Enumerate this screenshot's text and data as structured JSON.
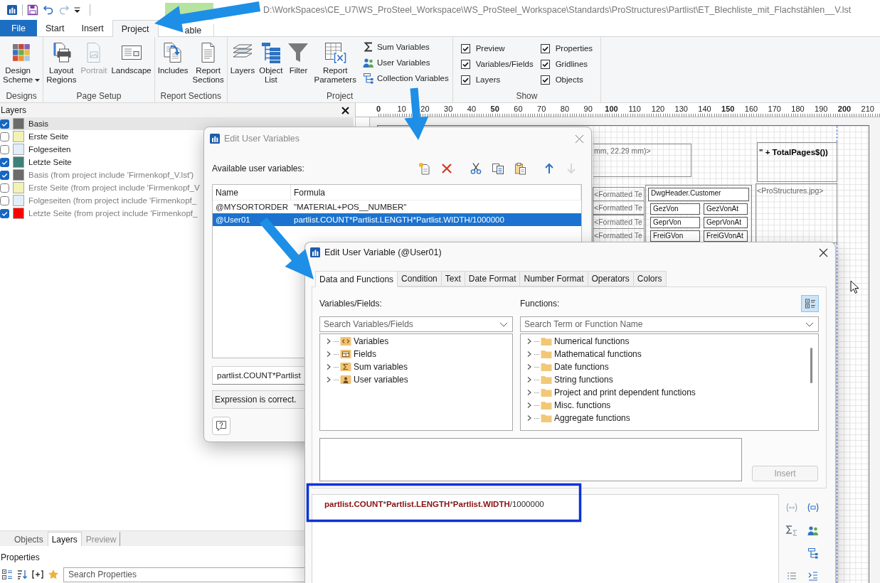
{
  "title_bar": {
    "quick_access": [
      {
        "kind": "save",
        "disabled": false
      },
      {
        "kind": "undo",
        "disabled": false
      },
      {
        "kind": "redo",
        "disabled": true
      },
      {
        "kind": "customize",
        "disabled": false
      }
    ],
    "path": "D:\\WorkSpaces\\CE_U7\\WS_ProSteel_Workspace\\WS_ProSteel_Workspace\\Standards\\ProStructures\\Partlist\\ET_Blechliste_mit_Flachstählen__V.lst"
  },
  "ribbon_tabs": [
    {
      "label": "File",
      "kind": "file",
      "selected": false
    },
    {
      "label": "Start",
      "kind": "tab",
      "selected": false
    },
    {
      "label": "Insert",
      "kind": "tab",
      "selected": false
    },
    {
      "label": "Project",
      "kind": "tab",
      "selected": true
    },
    {
      "label": "able",
      "kind": "context",
      "selected": false
    }
  ],
  "ribbon_groups": [
    {
      "label": "Designs",
      "items": [
        {
          "kind": "scheme",
          "label": "Design Scheme",
          "dropdown": true,
          "disabled": false
        }
      ]
    },
    {
      "label": "Page Setup",
      "items": [
        {
          "kind": "layout",
          "label": "Layout Regions",
          "dropdown": false,
          "disabled": false
        },
        {
          "kind": "portrait",
          "label": "Portrait",
          "dropdown": false,
          "disabled": true
        },
        {
          "kind": "landscape",
          "label": "Landscape",
          "dropdown": false,
          "disabled": false
        }
      ]
    },
    {
      "label": "Report Sections",
      "items": [
        {
          "kind": "includes",
          "label": "Includes",
          "dropdown": false,
          "disabled": false
        },
        {
          "kind": "sections",
          "label": "Report Sections",
          "dropdown": false,
          "disabled": false
        }
      ]
    },
    {
      "label": "Project",
      "items": [
        {
          "kind": "layers",
          "label": "Layers",
          "dropdown": false,
          "disabled": false
        },
        {
          "kind": "objects",
          "label": "Object List",
          "dropdown": false,
          "disabled": false
        },
        {
          "kind": "filter",
          "label": "Filter",
          "dropdown": false,
          "disabled": false
        },
        {
          "kind": "parameters",
          "label": "Report Parameters",
          "dropdown": false,
          "disabled": false
        }
      ],
      "small_items": [
        {
          "kind": "sum",
          "label": "Sum Variables"
        },
        {
          "kind": "users",
          "label": "User Variables"
        },
        {
          "kind": "collection",
          "label": "Collection Variables"
        }
      ]
    },
    {
      "label": "Show",
      "checkboxes": [
        {
          "label": "Preview",
          "checked": true
        },
        {
          "label": "Variables/Fields",
          "checked": true
        },
        {
          "label": "Layers",
          "checked": true
        },
        {
          "label": "Properties",
          "checked": true
        },
        {
          "label": "Gridlines",
          "checked": true
        },
        {
          "label": "Objects",
          "checked": true
        }
      ]
    }
  ],
  "layers_panel": {
    "title": "Layers",
    "items": [
      {
        "label": "Basis",
        "checked": true,
        "color": "#6b6b6b",
        "inherited": false,
        "selected": true
      },
      {
        "label": "Erste Seite",
        "checked": false,
        "color": "#f2f2b6",
        "inherited": false,
        "selected": false
      },
      {
        "label": "Folgeseiten",
        "checked": false,
        "color": "#e2eefa",
        "inherited": false,
        "selected": false
      },
      {
        "label": "Letzte Seite",
        "checked": true,
        "color": "#3e8079",
        "inherited": false,
        "selected": false
      },
      {
        "label": "Basis (from project include 'Firmenkopf_V.lst')",
        "checked": true,
        "color": "#6b6b6b",
        "inherited": true,
        "selected": false
      },
      {
        "label": "Erste Seite (from project include 'Firmenkopf_V",
        "checked": false,
        "color": "#f2f2b6",
        "inherited": true,
        "selected": false
      },
      {
        "label": "Folgeseiten (from project include 'Firmenkopf_",
        "checked": false,
        "color": "#e2eefa",
        "inherited": true,
        "selected": false
      },
      {
        "label": "Letzte Seite (from project include 'Firmenkopf_",
        "checked": true,
        "color": "#ff0000",
        "inherited": true,
        "selected": false
      }
    ]
  },
  "bottom_tabs": [
    {
      "label": "Objects",
      "selected": false,
      "disabled": false
    },
    {
      "label": "Layers",
      "selected": true,
      "disabled": false
    },
    {
      "label": "Preview",
      "selected": false,
      "disabled": true
    }
  ],
  "properties": {
    "title": "Properties",
    "search": {
      "placeholder": "Search Properties"
    }
  },
  "ruler": [
    {
      "label": "0",
      "major": true
    },
    {
      "label": "10",
      "major": false
    },
    {
      "label": "20",
      "major": false
    },
    {
      "label": "30",
      "major": false
    },
    {
      "label": "40",
      "major": false
    },
    {
      "label": "50",
      "major": true
    },
    {
      "label": "60",
      "major": false
    },
    {
      "label": "70",
      "major": false
    },
    {
      "label": "80",
      "major": false
    },
    {
      "label": "90",
      "major": false
    },
    {
      "label": "100",
      "major": true
    },
    {
      "label": "110",
      "major": false
    },
    {
      "label": "120",
      "major": false
    },
    {
      "label": "130",
      "major": false
    },
    {
      "label": "140",
      "major": false
    },
    {
      "label": "150",
      "major": true
    },
    {
      "label": "160",
      "major": false
    },
    {
      "label": "170",
      "major": false
    },
    {
      "label": "180",
      "major": false
    },
    {
      "label": "190",
      "major": false
    },
    {
      "label": "200",
      "major": true
    },
    {
      "label": "210",
      "major": false
    }
  ],
  "report_objects": [
    {
      "text": "mm, 22.29 mm)>",
      "kind": "text"
    },
    {
      "text": "\" + TotalPages$())",
      "kind": "expression"
    },
    {
      "text": "<Formatted Te",
      "kind": "text"
    },
    {
      "text": "DwgHeader.Customer",
      "kind": "field"
    },
    {
      "text": "<ProStructures.jpg>",
      "kind": "image"
    },
    {
      "text": "<Formatted Te",
      "kind": "text"
    },
    {
      "text": "GezVon",
      "kind": "field"
    },
    {
      "text": "GezVonAt",
      "kind": "field"
    },
    {
      "text": "<Formatted Te",
      "kind": "text"
    },
    {
      "text": "GeprVon",
      "kind": "field"
    },
    {
      "text": "GeprVonAt",
      "kind": "field"
    },
    {
      "text": "<Formatted Te",
      "kind": "text"
    },
    {
      "text": "FreiGVon",
      "kind": "field"
    },
    {
      "text": "FreiGVonAt",
      "kind": "field"
    }
  ],
  "user_variables_dialog": {
    "title": "Edit User Variables",
    "active": false,
    "label": "Available user variables:",
    "toolbar": [
      {
        "kind": "new",
        "disabled": false
      },
      {
        "kind": "delete",
        "disabled": false
      },
      {
        "kind": "cut",
        "disabled": false
      },
      {
        "kind": "copy",
        "disabled": false
      },
      {
        "kind": "paste",
        "disabled": false
      },
      {
        "kind": "up",
        "disabled": false
      },
      {
        "kind": "down",
        "disabled": true
      }
    ],
    "columns": [
      "Name",
      "Formula"
    ],
    "rows": [
      {
        "name": "@MYSORTORDER",
        "formula": "\"MATERIAL+POS__NUMBER\"",
        "selected": false
      },
      {
        "name": "@User01",
        "formula": "partlist.COUNT*Partlist.LENGTH*Partlist.WIDTH/1000000",
        "selected": true
      }
    ],
    "expression": "partlist.COUNT*Partlist",
    "status": "Expression is correct."
  },
  "user_variable_dialog": {
    "title": "Edit User Variable (@User01)",
    "active": true,
    "tabs": [
      {
        "label": "Data and Functions",
        "selected": true
      },
      {
        "label": "Condition",
        "selected": false
      },
      {
        "label": "Text",
        "selected": false
      },
      {
        "label": "Date Format",
        "selected": false
      },
      {
        "label": "Number Format",
        "selected": false
      },
      {
        "label": "Operators",
        "selected": false
      },
      {
        "label": "Colors",
        "selected": false
      }
    ],
    "variables_label": "Variables/Fields:",
    "functions_label": "Functions:",
    "view_toggle": {
      "selected": true
    },
    "variables_search": {
      "placeholder": "Search Variables/Fields"
    },
    "functions_search": {
      "placeholder": "Search Term or Function Name"
    },
    "variables_tree": [
      {
        "label": "Variables",
        "kind": "variables",
        "expanded": false
      },
      {
        "label": "Fields",
        "kind": "fields",
        "expanded": false
      },
      {
        "label": "Sum variables",
        "kind": "sum",
        "expanded": false
      },
      {
        "label": "User variables",
        "kind": "users",
        "expanded": false
      }
    ],
    "functions_tree": [
      {
        "label": "Numerical functions",
        "expanded": false
      },
      {
        "label": "Mathematical functions",
        "expanded": false
      },
      {
        "label": "Date functions",
        "expanded": false
      },
      {
        "label": "String functions",
        "expanded": false
      },
      {
        "label": "Project and print dependent functions",
        "expanded": false
      },
      {
        "label": "Misc. functions",
        "expanded": false
      },
      {
        "label": "Aggregate functions",
        "expanded": false
      }
    ],
    "insert_button": {
      "label": "Insert",
      "disabled": true
    },
    "formula": [
      {
        "text": "partlist.COUNT",
        "kind": "field"
      },
      {
        "text": "*",
        "kind": "operator"
      },
      {
        "text": "Partlist.LENGTH",
        "kind": "field"
      },
      {
        "text": "*",
        "kind": "operator"
      },
      {
        "text": "Partlist.WIDTH",
        "kind": "field"
      },
      {
        "text": "/1000000",
        "kind": "operator"
      }
    ]
  }
}
